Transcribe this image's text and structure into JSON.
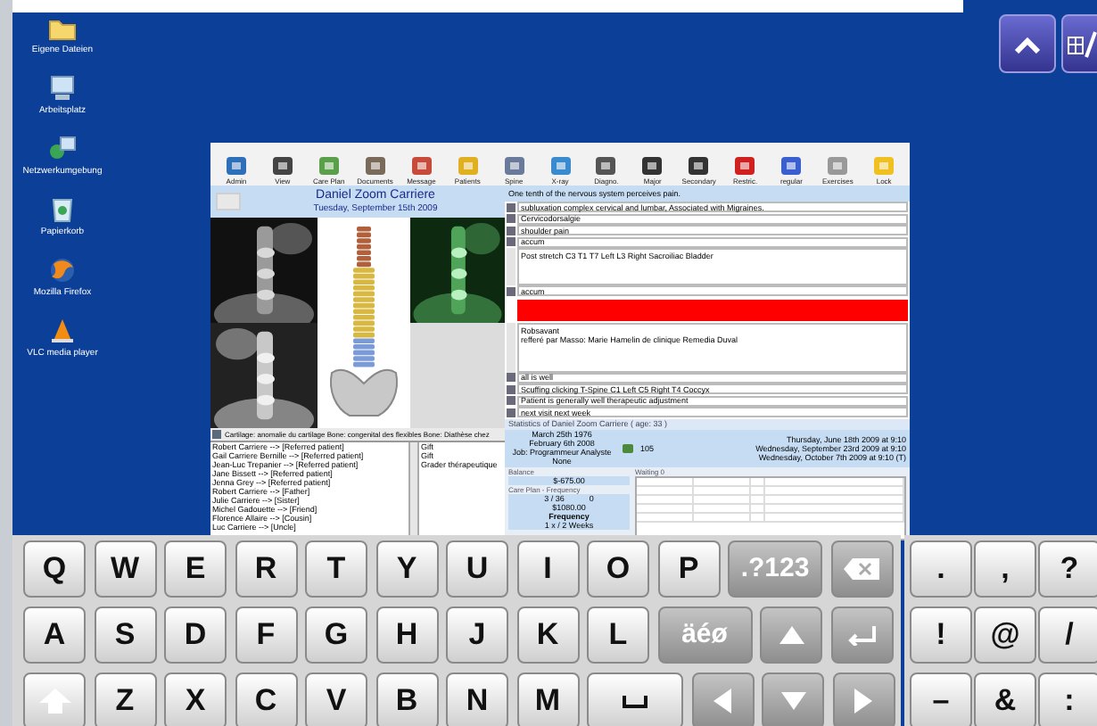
{
  "desktop_icons": [
    {
      "label": "Eigene Dateien"
    },
    {
      "label": "Arbeitsplatz"
    },
    {
      "label": "Netzwerkumgebung"
    },
    {
      "label": "Papierkorb"
    },
    {
      "label": "Mozilla Firefox"
    },
    {
      "label": "VLC media player"
    }
  ],
  "app": {
    "toolbar": [
      {
        "label": "Admin"
      },
      {
        "label": "View"
      },
      {
        "label": "Care Plan"
      },
      {
        "label": "Documents"
      },
      {
        "label": "Message"
      },
      {
        "label": "Patients"
      },
      {
        "label": "Spine"
      },
      {
        "label": "X-ray"
      },
      {
        "label": "Diagno."
      },
      {
        "label": "Major"
      },
      {
        "label": "Secondary"
      },
      {
        "label": "Restric."
      },
      {
        "label": "regular"
      },
      {
        "label": "Exercises"
      },
      {
        "label": "Lock"
      }
    ],
    "patient": {
      "name": "Daniel Zoom Carriere",
      "date": "Tuesday, September 15th 2009"
    },
    "quote": "One tenth of the nervous system perceives pain.",
    "diagnosis": "Cartilage: anomalie du cartilage Bone: congenital des flexibles Bone: Diathèse chez",
    "relations": [
      "Robert Carriere --> [Referred patient]",
      "Gail Carriere Bernille --> [Referred patient]",
      "Jean-Luc Trepanier --> [Referred patient]",
      "Jane Bissett --> [Referred patient]",
      "Jenna Grey --> [Referred patient]",
      "Robert Carriere --> [Father]",
      "Julie Carriere --> [Sister]",
      "Michel Gadouette --> [Friend]",
      "Florence Allaire --> [Cousin]",
      "Luc Carriere --> [Uncle]"
    ],
    "remarks": [
      "Gift",
      "Gift",
      "Grader thérapeutique"
    ],
    "notes": [
      {
        "kind": "line",
        "text": "subluxation complex cervical and lumbar, Associated with Migraines."
      },
      {
        "kind": "line",
        "text": "Cervicodorsalgie"
      },
      {
        "kind": "line",
        "text": "shoulder pain"
      },
      {
        "kind": "line",
        "text": "accum"
      },
      {
        "kind": "area",
        "lines": [
          "Post stretch C3 T1 T7 Left L3 Right Sacroiliac Bladder"
        ]
      },
      {
        "kind": "line",
        "text": "accum"
      },
      {
        "kind": "alert"
      },
      {
        "kind": "area",
        "lines": [
          "Robsavant",
          "refferé par Masso: Marie Hamelin de clinique Remedia Duval"
        ]
      },
      {
        "kind": "line",
        "text": "all is well"
      },
      {
        "kind": "line",
        "text": "Scuffing clicking T-Spine C1 Left C5 Right T4 Coccyx"
      },
      {
        "kind": "line",
        "text": "Patient is generally well therapeutic adjustment"
      },
      {
        "kind": "line",
        "text": "next visit next week"
      }
    ],
    "stats": {
      "title": "Statistics of Daniel Zoom Carriere ( age: 33 )",
      "facts": [
        "March 25th 1976",
        "February 6th 2008",
        "Job: Programmeur Analyste",
        "None"
      ],
      "count": "105",
      "appointments": [
        "Thursday, June 18th 2009 at 9:10",
        "Wednesday, September 23rd 2009 at 9:10",
        "Wednesday, October 7th 2009 at 9:10 (T)"
      ]
    },
    "balance": {
      "title": "Balance",
      "amount": "$-675.00",
      "plan_title": "Care Plan - Frequency",
      "visits": "3 / 36",
      "missed": "0",
      "plan_amount": "$1080.00",
      "frequency_label": "Frequency",
      "frequency": "1 x / 2 Weeks"
    },
    "waiting": {
      "title": "Waiting 0"
    }
  },
  "keyboard": {
    "rows": [
      [
        {
          "kind": "letter",
          "label": "Q"
        },
        {
          "kind": "letter",
          "label": "W"
        },
        {
          "kind": "letter",
          "label": "E"
        },
        {
          "kind": "letter",
          "label": "R"
        },
        {
          "kind": "letter",
          "label": "T"
        },
        {
          "kind": "letter",
          "label": "Y"
        },
        {
          "kind": "letter",
          "label": "U"
        },
        {
          "kind": "letter",
          "label": "I"
        },
        {
          "kind": "letter",
          "label": "O"
        },
        {
          "kind": "letter",
          "label": "P"
        },
        {
          "kind": "mode",
          "label": ".?123"
        },
        {
          "kind": "backspace"
        }
      ],
      [
        {
          "kind": "letter",
          "label": "A"
        },
        {
          "kind": "letter",
          "label": "S"
        },
        {
          "kind": "letter",
          "label": "D"
        },
        {
          "kind": "letter",
          "label": "F"
        },
        {
          "kind": "letter",
          "label": "G"
        },
        {
          "kind": "letter",
          "label": "H"
        },
        {
          "kind": "letter",
          "label": "J"
        },
        {
          "kind": "letter",
          "label": "K"
        },
        {
          "kind": "letter",
          "label": "L"
        },
        {
          "kind": "mode",
          "label": "äéø"
        },
        {
          "kind": "up"
        },
        {
          "kind": "enter"
        }
      ],
      [
        {
          "kind": "shift"
        },
        {
          "kind": "letter",
          "label": "Z"
        },
        {
          "kind": "letter",
          "label": "X"
        },
        {
          "kind": "letter",
          "label": "C"
        },
        {
          "kind": "letter",
          "label": "V"
        },
        {
          "kind": "letter",
          "label": "B"
        },
        {
          "kind": "letter",
          "label": "N"
        },
        {
          "kind": "letter",
          "label": "M"
        },
        {
          "kind": "space"
        },
        {
          "kind": "left"
        },
        {
          "kind": "down"
        },
        {
          "kind": "right"
        }
      ]
    ],
    "side_rows": [
      [
        ".",
        ",",
        "?"
      ],
      [
        "!",
        "@",
        "/"
      ],
      [
        "–",
        "&",
        ":"
      ]
    ]
  }
}
